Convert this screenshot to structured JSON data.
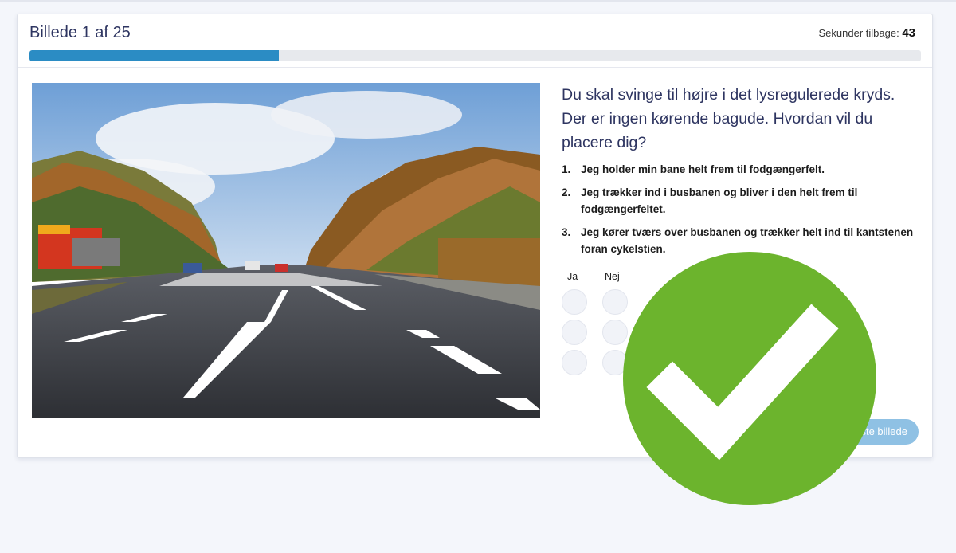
{
  "header": {
    "title": "Billede 1 af 25",
    "timer_label": "Sekunder tilbage:",
    "timer_value": "43",
    "progress_fraction": 0.28
  },
  "question": {
    "text": "Du skal svinge til højre i det lysregulerede kryds. Der er ingen kørende bagude. Hvordan vil du placere dig?",
    "answers": [
      {
        "number": "1.",
        "text": "Jeg holder min bane helt frem til fodgængerfelt."
      },
      {
        "number": "2.",
        "text": "Jeg trækker ind i busbanen og bliver i den helt frem til fodgængerfeltet."
      },
      {
        "number": "3.",
        "text": "Jeg kører tværs over busbanen og trækker helt ind til kantstenen foran cykelstien."
      }
    ],
    "yes_label": "Ja",
    "no_label": "Nej"
  },
  "next_button": {
    "label": "ste billede"
  },
  "result": {
    "icon": "checkmark-icon",
    "color": "#6cb42d"
  },
  "colors": {
    "progress": "#2b8cc4",
    "button": "#8fc1e4",
    "title": "#2e3561"
  }
}
